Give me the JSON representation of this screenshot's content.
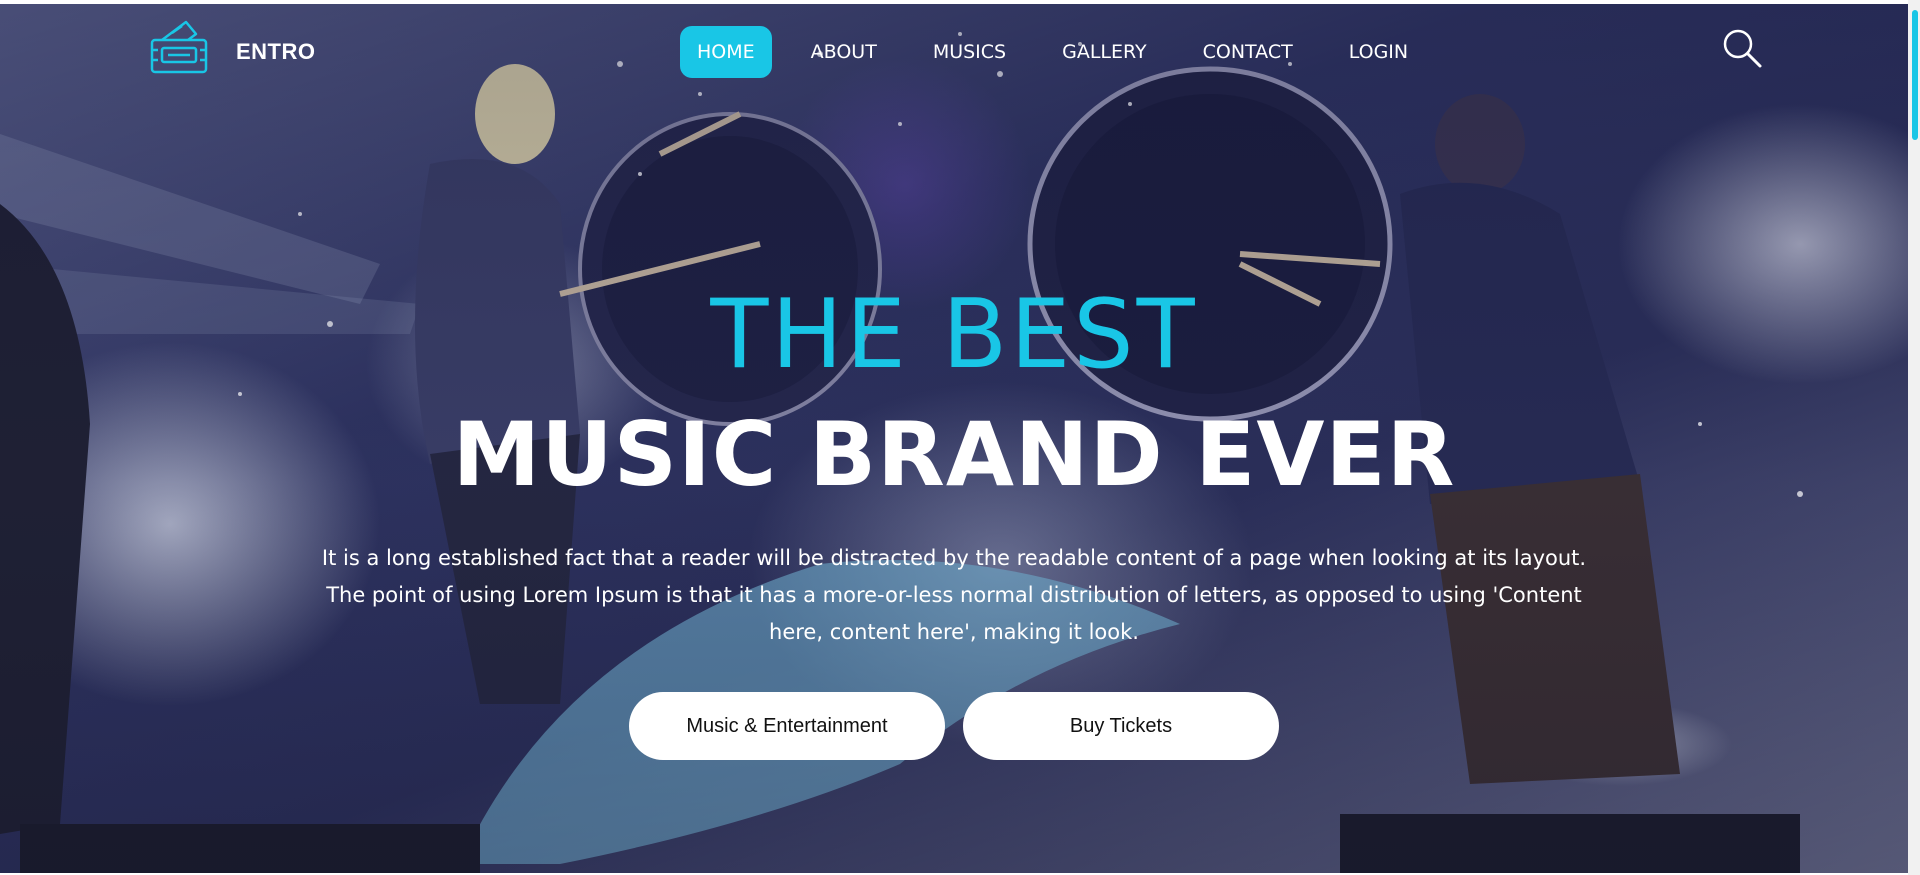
{
  "brand": {
    "name": "ENTRO",
    "logo_icon": "ticket-icon",
    "accent": "#19c6e6"
  },
  "nav": {
    "items": [
      {
        "label": "HOME",
        "active": true
      },
      {
        "label": "ABOUT",
        "active": false
      },
      {
        "label": "MUSICS",
        "active": false
      },
      {
        "label": "GALLERY",
        "active": false
      },
      {
        "label": "CONTACT",
        "active": false
      },
      {
        "label": "LOGIN",
        "active": false
      }
    ],
    "search_icon": "search-icon"
  },
  "hero": {
    "line1": "THE BEST",
    "line2": "MUSIC BRAND EVER",
    "description": "It is a long established fact that a reader will be distracted by the readable content of a page when looking at its layout. The point of using Lorem Ipsum is that it has a more-or-less normal distribution of letters, as opposed to using 'Content here, content here', making it look.",
    "buttons": [
      {
        "label": "Music & Entertainment"
      },
      {
        "label": "Buy Tickets"
      }
    ]
  }
}
